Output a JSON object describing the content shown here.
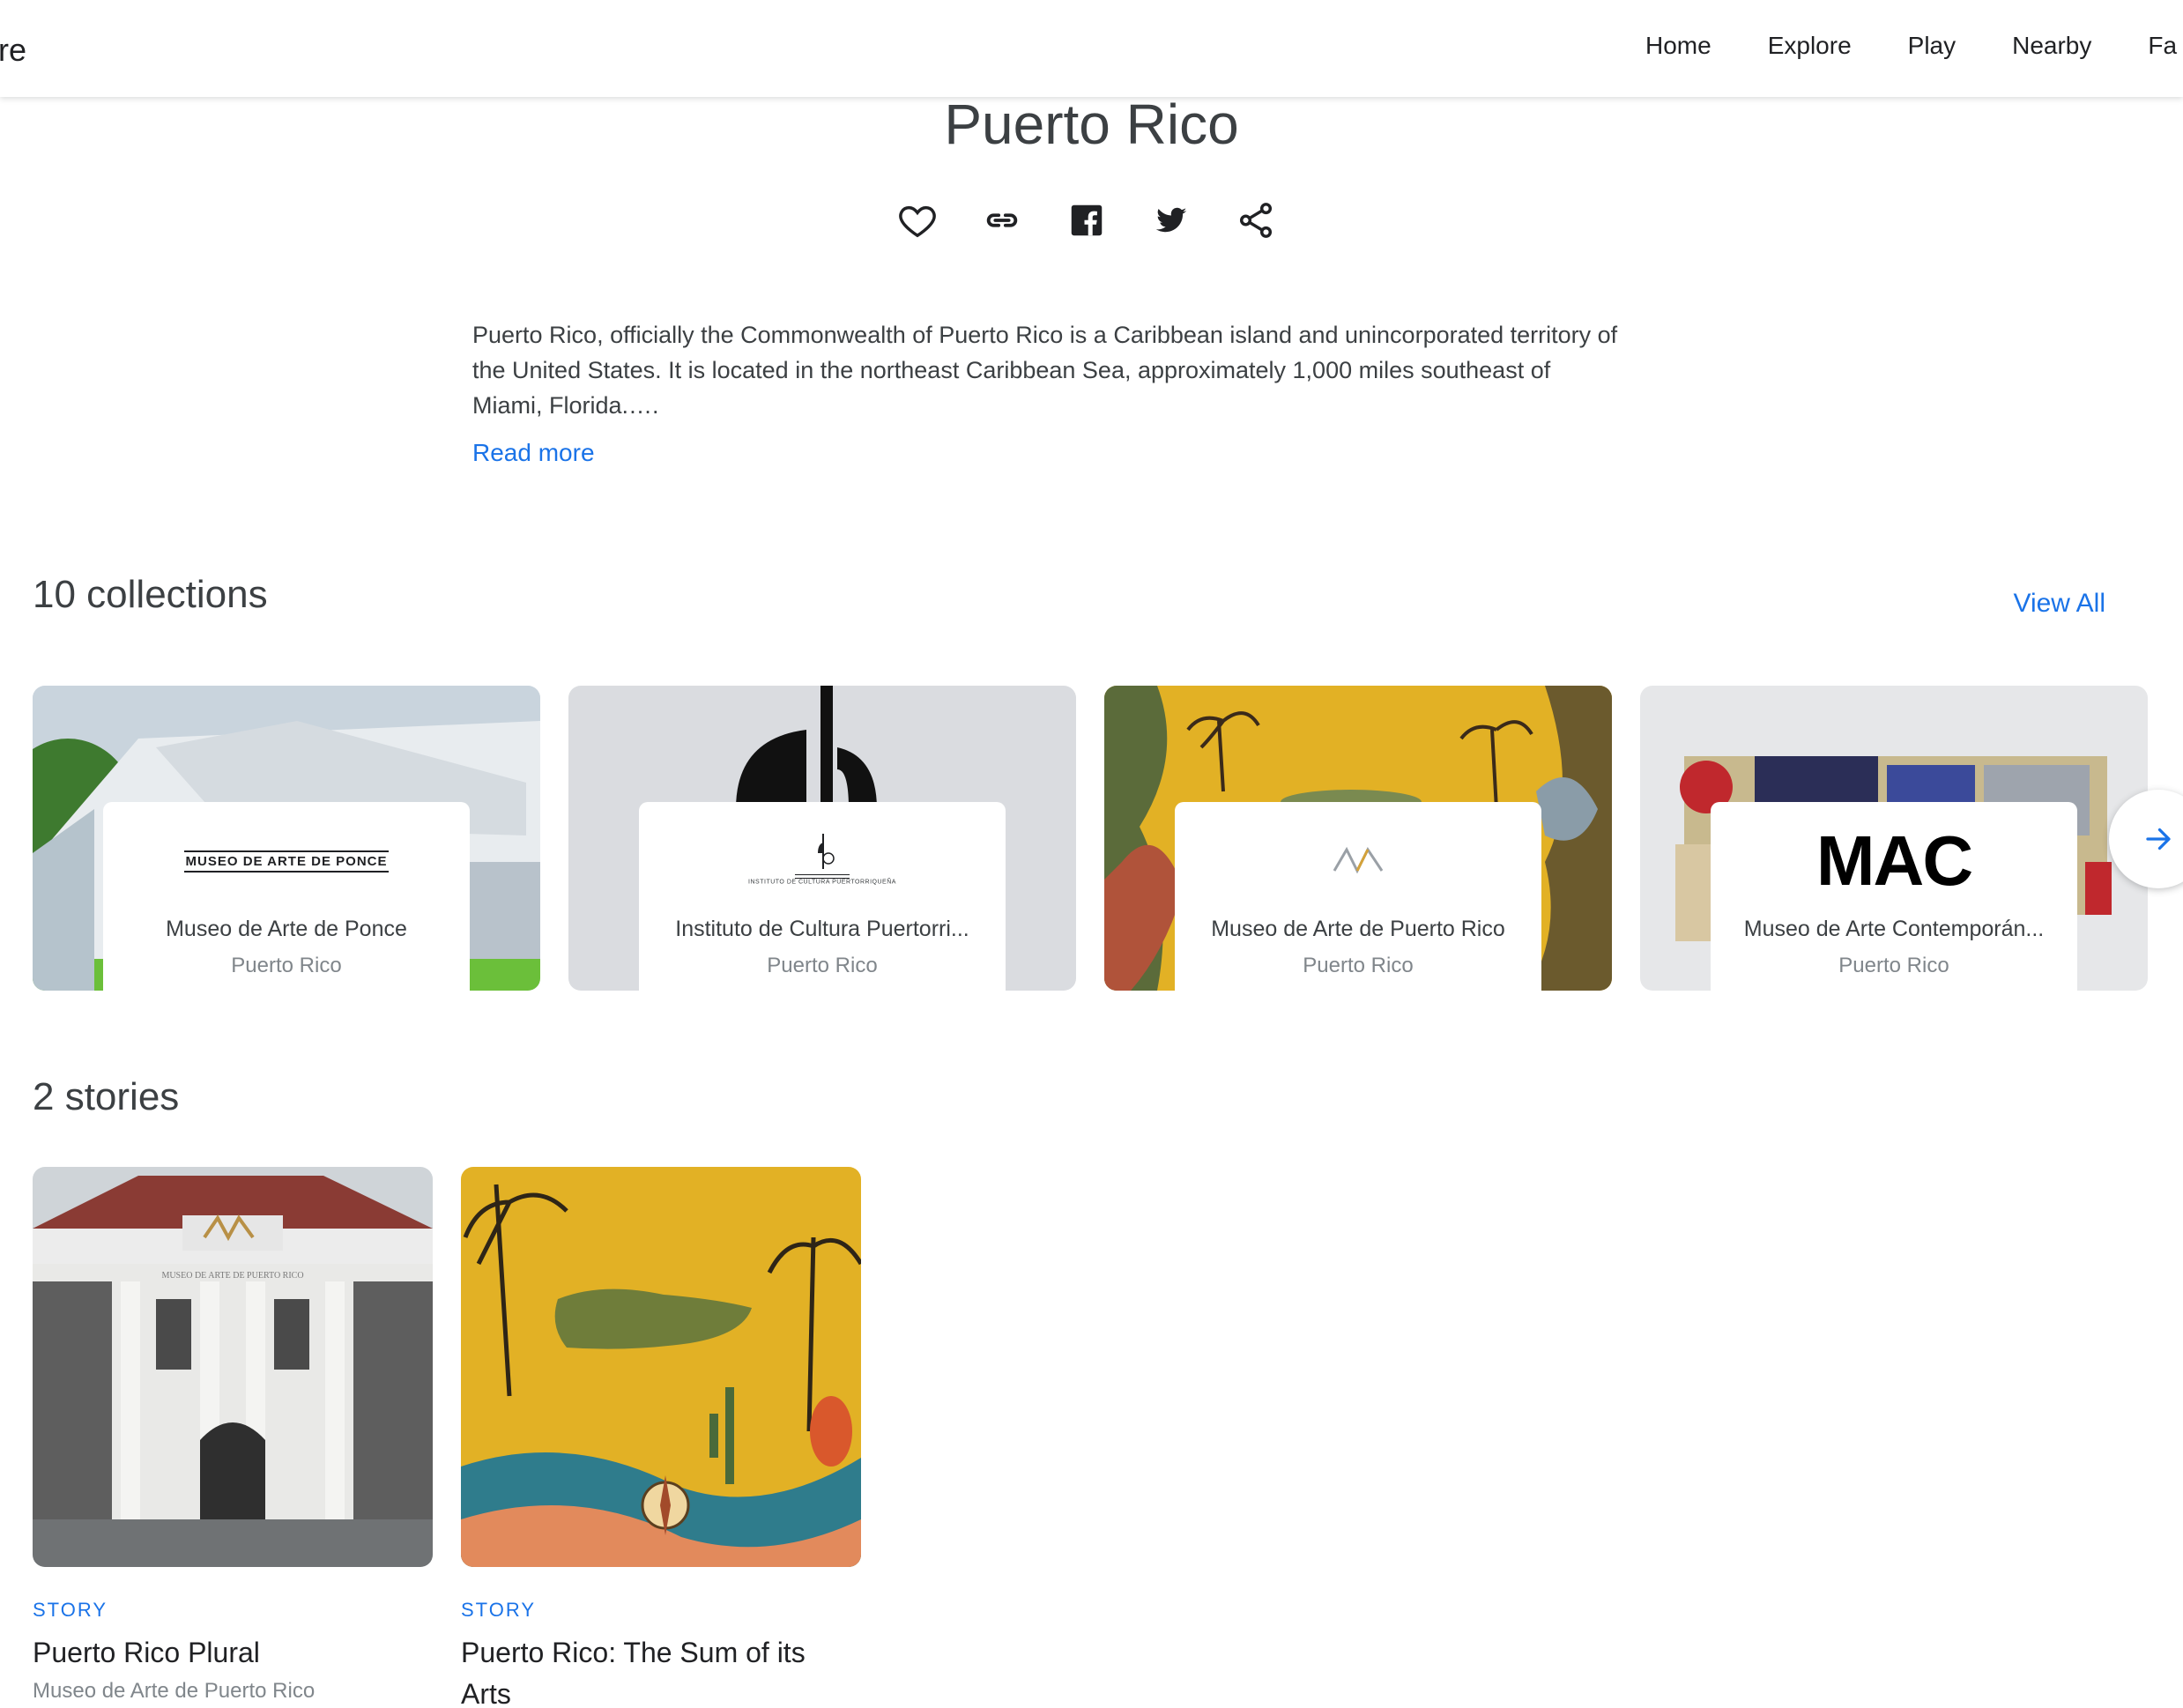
{
  "header": {
    "brand_fragment": "re",
    "nav": [
      "Home",
      "Explore",
      "Play",
      "Nearby",
      "Fa"
    ]
  },
  "page": {
    "title": "Puerto Rico",
    "share_icons": [
      "heart-icon",
      "link-icon",
      "facebook-icon",
      "twitter-icon",
      "share-icon"
    ],
    "description_lines": [
      "Puerto Rico, officially the Commonwealth of Puerto Rico is a Caribbean island and unincorporated territory of",
      "the United States. It is located in the northeast Caribbean Sea, approximately 1,000 miles southeast of",
      "Miami, Florida.…."
    ],
    "read_more": "Read more"
  },
  "collections": {
    "heading": "10 collections",
    "view_all": "View All",
    "items": [
      {
        "name": "Museo de Arte de Ponce",
        "location": "Puerto Rico",
        "logo_text": "MUSEO DE ARTE DE PONCE"
      },
      {
        "name": "Instituto de Cultura Puertorri...",
        "location": "Puerto Rico",
        "logo_text": "INSTITUTO DE CULTURA PUERTORRIQUEÑA"
      },
      {
        "name": "Museo de Arte de Puerto Rico",
        "location": "Puerto Rico",
        "logo_text": ""
      },
      {
        "name": "Museo de Arte Contemporán...",
        "location": "Puerto Rico",
        "logo_text": "MAC"
      }
    ]
  },
  "stories": {
    "heading": "2 stories",
    "items": [
      {
        "kicker": "STORY",
        "title": "Puerto Rico Plural",
        "subtitle": "Museo de Arte de Puerto Rico",
        "sign_text": "MUSEO DE ARTE DE PUERTO RICO"
      },
      {
        "kicker": "STORY",
        "title": "Puerto Rico: The Sum of its Arts",
        "subtitle": ""
      }
    ]
  },
  "colors": {
    "link": "#1a73e8",
    "text": "#202124",
    "muted": "#80868b",
    "mural_yellow": "#e2b125"
  }
}
